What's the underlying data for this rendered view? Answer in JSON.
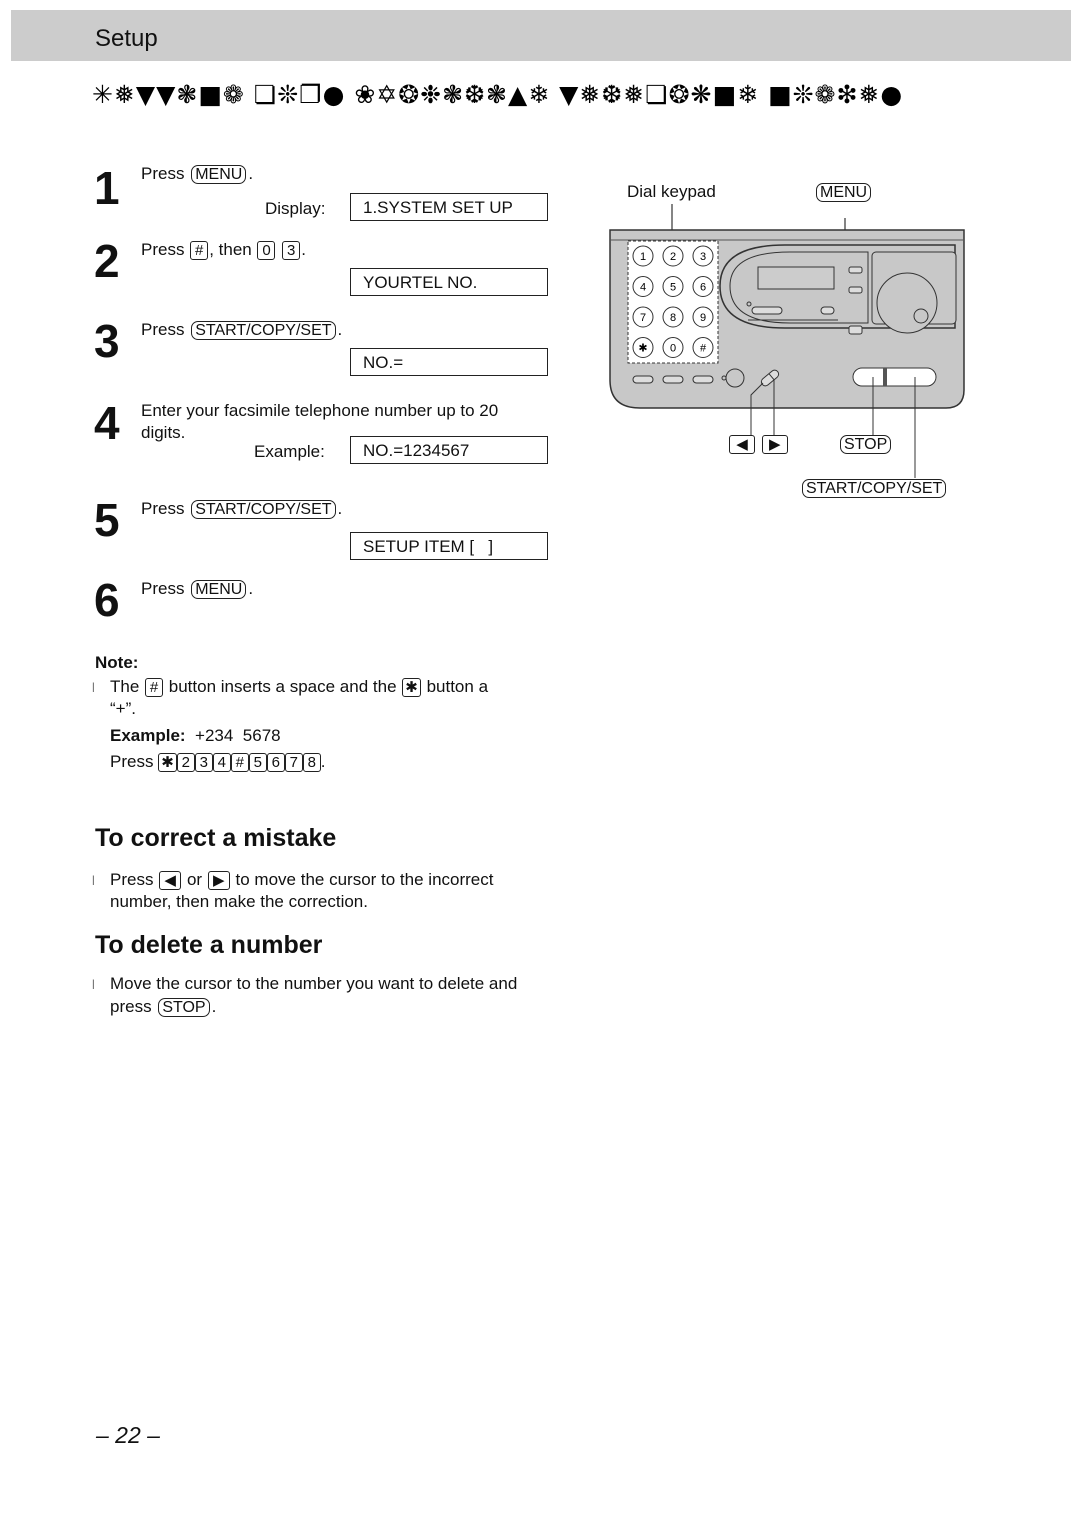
{
  "header": {
    "section": "Setup"
  },
  "title_dingbats": "✳❅▼▼❃■❁ ❏❊❐● ❀✡❂❉❃❆❃▲❄ ▼❅❆❅❏❂❋■❄ ■❊❁❇❅●",
  "title_meaning": "Entering your facsimile telephone number",
  "steps": [
    {
      "num": "1",
      "press": "Press",
      "key": "MENU",
      "display_label": "Display:",
      "display": "1.SYSTEM SET UP"
    },
    {
      "num": "2",
      "press": "Press",
      "key": "#",
      "then": ", then",
      "keys": [
        "0",
        "3"
      ],
      "display": "YOURTEL NO."
    },
    {
      "num": "3",
      "press": "Press",
      "key": "START/COPY/SET",
      "display": "NO.="
    },
    {
      "num": "4",
      "text_line1": "Enter your facsimile telephone number up to 20",
      "text_line2": "digits.",
      "display_label": "Example:",
      "display": "NO.=1234567"
    },
    {
      "num": "5",
      "press": "Press",
      "key": "START/COPY/SET",
      "display": "SETUP ITEM [   ]"
    },
    {
      "num": "6",
      "press": "Press",
      "key": "MENU"
    }
  ],
  "note": {
    "heading": "Note:",
    "line1_a": "The",
    "line1_key1": "#",
    "line1_b": "button inserts a space and the",
    "line1_key2": "✱",
    "line1_c": "button a",
    "line2": "“+”.",
    "example_label": "Example:",
    "example_value": "+234  5678",
    "press": "Press",
    "keys": [
      "✱",
      "2",
      "3",
      "4",
      "#",
      "5",
      "6",
      "7",
      "8"
    ]
  },
  "correct": {
    "heading": "To correct a mistake",
    "press": "Press",
    "or": "or",
    "text1": "to move the cursor to the incorrect",
    "text2": "number, then make the correction."
  },
  "delete": {
    "heading": "To delete a number",
    "text1": "Move the cursor to the number you want to delete and",
    "press": "press",
    "key": "STOP"
  },
  "diagram": {
    "dial_keypad": "Dial keypad",
    "menu": "MENU",
    "stop": "STOP",
    "start": "START/COPY/SET",
    "keypad": [
      "1",
      "2",
      "3",
      "4",
      "5",
      "6",
      "7",
      "8",
      "9",
      "✱",
      "0",
      "#"
    ]
  },
  "page_number": "– 22 –"
}
